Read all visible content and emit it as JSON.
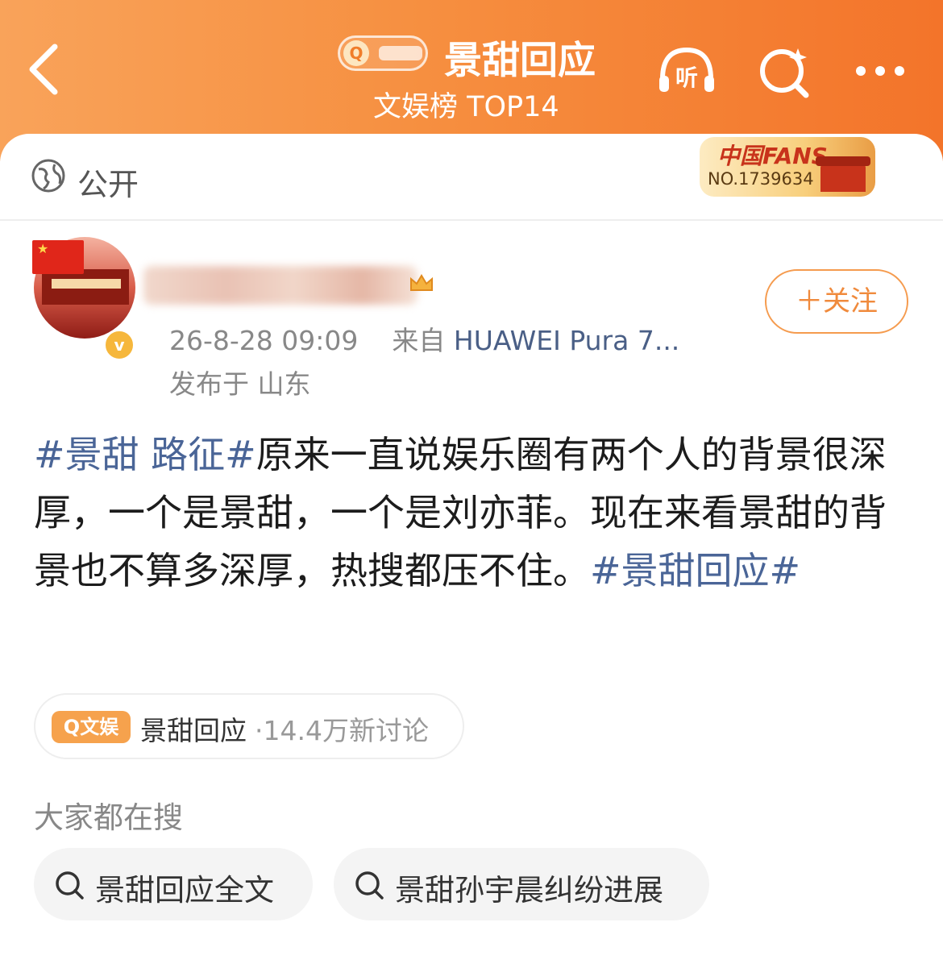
{
  "header": {
    "back_icon": "chevron-left-icon",
    "topic_logo_icon": "search-topic-icon",
    "title": "景甜回应",
    "rank_label": "文娱榜 TOP14",
    "listen_label": "听",
    "search_icon": "search-sparkle-icon",
    "more_icon": "more-dots-icon",
    "bg_start": "#f9a35a",
    "bg_end": "#f3742a"
  },
  "visibility": {
    "icon": "globe-icon",
    "label": "公开"
  },
  "fans_badge": {
    "title": "中国FANS",
    "number": "NO.1739634"
  },
  "post": {
    "avatar_icon": "avatar",
    "verified_icon": "verified-icon",
    "verified_mark": "v",
    "time": "26-8-28 09:09",
    "source_prefix": "来自",
    "device": "HUAWEI Pura 7...",
    "location": "发布于 山东",
    "follow_label": "＋关注",
    "tag1": "#景甜 路征#",
    "text": "原来一直说娱乐圈有两个人的背景很深厚，一个是景甜，一个是刘亦菲。现在来看景甜的背景也不算多深厚，热搜都压不住。",
    "tag2": "#景甜回应#"
  },
  "topic": {
    "badge": "Q文娱",
    "name": "景甜回应",
    "count": "·14.4万新讨论"
  },
  "related": {
    "title": "大家都在搜",
    "items": [
      {
        "label": "景甜回应全文",
        "icon": "search-icon"
      },
      {
        "label": "景甜孙宇晨纠纷进展",
        "icon": "search-icon"
      }
    ]
  },
  "colors": {
    "accent_orange": "#f08a3c",
    "link_blue": "#4a6597"
  }
}
